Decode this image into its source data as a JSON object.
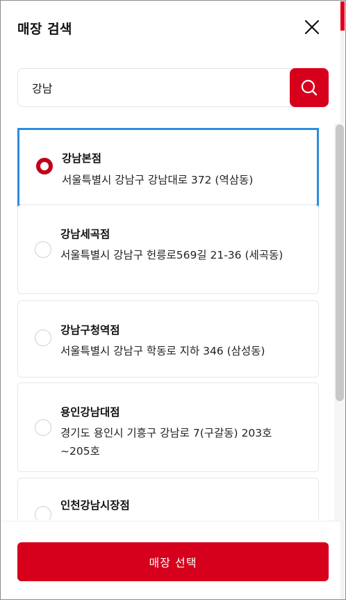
{
  "modal": {
    "title": "매장 검색",
    "close_icon": "close-icon"
  },
  "search": {
    "value": "강남",
    "button_icon": "search-icon"
  },
  "stores": [
    {
      "name": "강남본점",
      "address": "서울특별시 강남구 강남대로 372 (역삼동)",
      "selected": true
    },
    {
      "name": "강남세곡점",
      "address": "서울특별시 강남구 헌릉로569길 21-36 (세곡동)",
      "selected": false
    },
    {
      "name": "강남구청역점",
      "address": "서울특별시 강남구 학동로 지하 346 (삼성동)",
      "selected": false
    },
    {
      "name": "용인강남대점",
      "address": "경기도 용인시 기흥구 강남로 7(구갈동) 203호 ~205호",
      "selected": false
    },
    {
      "name": "인천강남시장점",
      "address": "",
      "selected": false
    }
  ],
  "footer": {
    "submit_label": "매장 선택"
  },
  "colors": {
    "accent": "#d7001c",
    "selection_outline": "#2a8de0"
  }
}
